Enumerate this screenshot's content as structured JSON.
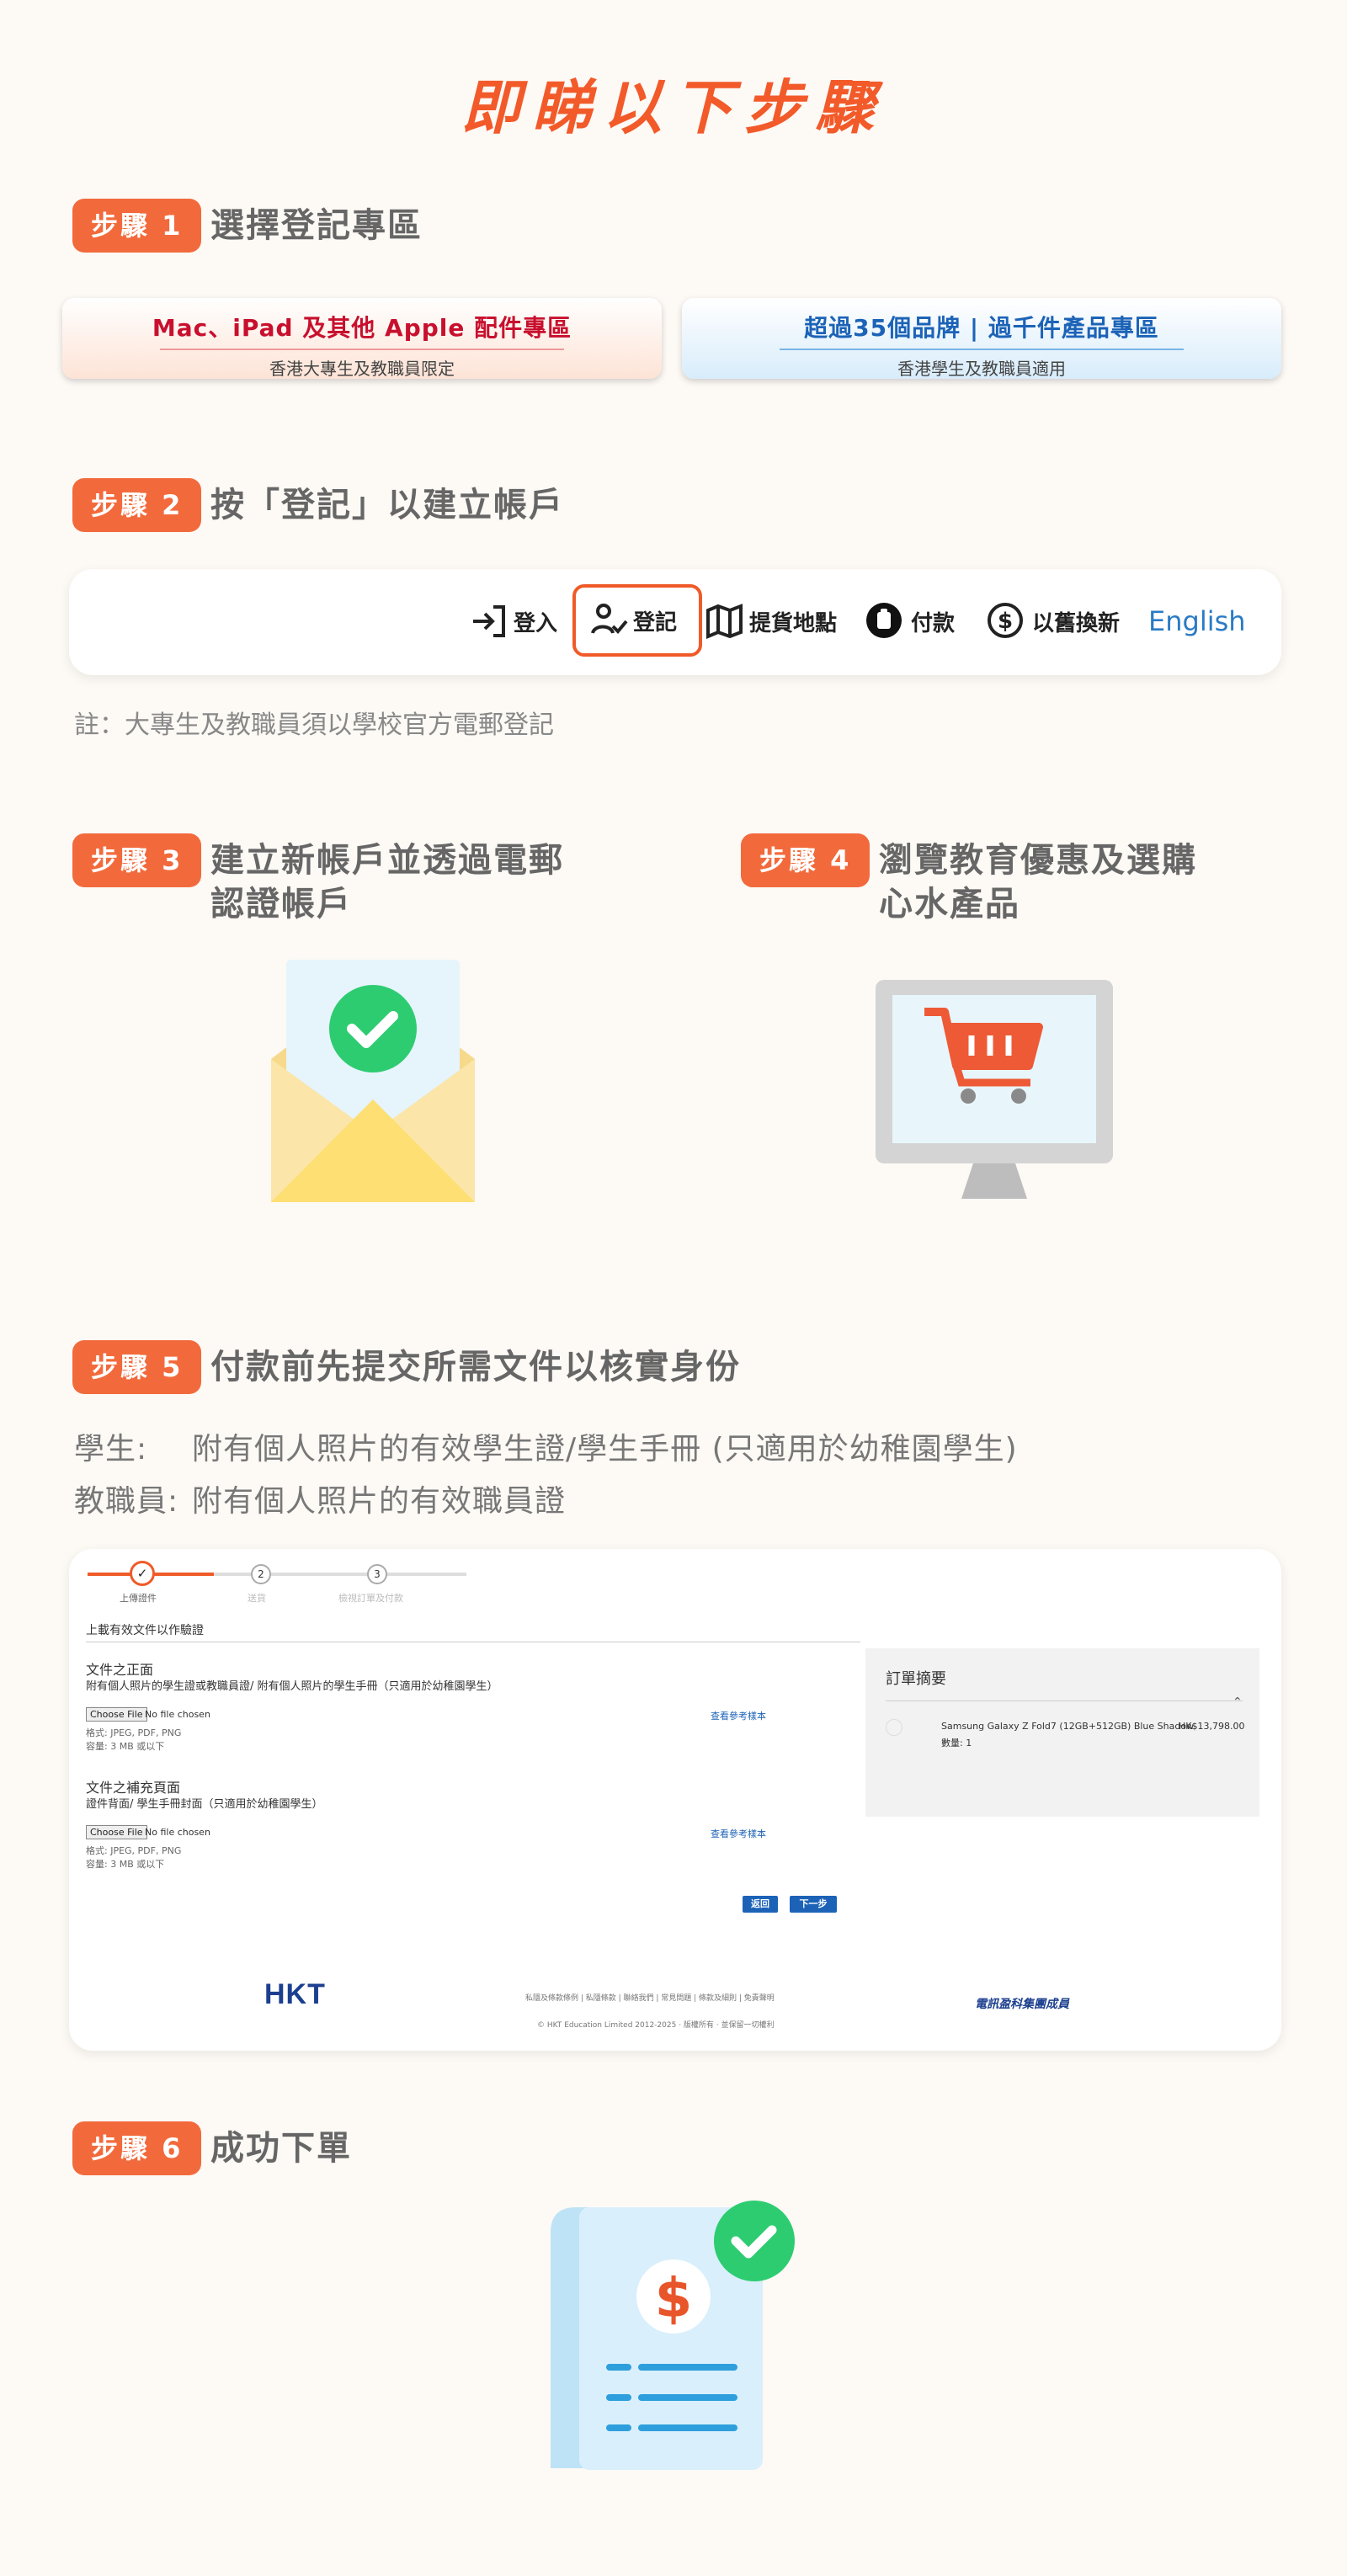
{
  "title": "即睇以下步驟",
  "steps": {
    "s1": {
      "badge": "步驟 1",
      "label": "選擇登記專區"
    },
    "s2": {
      "badge": "步驟 2",
      "label": "按「登記」以建立帳戶"
    },
    "s3": {
      "badge": "步驟 3",
      "label_line1": "建立新帳戶並透過電郵",
      "label_line2": "認證帳戶"
    },
    "s4": {
      "badge": "步驟 4",
      "label_line1": "瀏覽教育優惠及選購",
      "label_line2": "心水產品"
    },
    "s5": {
      "badge": "步驟 5",
      "label": "付款前先提交所需文件以核實身份"
    },
    "s6": {
      "badge": "步驟 6",
      "label": "成功下單"
    }
  },
  "zones": {
    "apple": {
      "title": "Mac、iPad 及其他 Apple 配件專區",
      "subtitle": "香港大專生及教職員限定"
    },
    "brands": {
      "title": "超過35個品牌 | 過千件產品專區",
      "subtitle": "香港學生及教職員適用"
    }
  },
  "nav": {
    "login": "登入",
    "register": "登記",
    "pickup": "提貨地點",
    "payment": "付款",
    "tradein": "以舊換新",
    "language": "English"
  },
  "note": "註：大專生及教職員須以學校官方電郵登記",
  "documents": {
    "student_label": "學生:",
    "student_text": "附有個人照片的有效學生證/學生手冊 (只適用於幼稚園學生)",
    "staff_label": "教職員:",
    "staff_text": "附有個人照片的有效職員證"
  },
  "form_screenshot": {
    "progress": [
      {
        "num": "✓",
        "label": "上傳證件"
      },
      {
        "num": "2",
        "label": "送貨"
      },
      {
        "num": "3",
        "label": "檢視訂單及付款"
      }
    ],
    "section_title": "上載有效文件以作驗證",
    "front_title": "文件之正面",
    "front_desc": "附有個人照片的學生證或教職員證/ 附有個人照片的學生手冊（只適用於幼稚園學生）",
    "choose_file": "Choose File",
    "no_file": "No file chosen",
    "format": "格式: JPEG, PDF, PNG",
    "size": "容量: 3 MB 或以下",
    "sample_link": "查看參考樣本",
    "back_title": "文件之補充頁面",
    "back_desc": "證件背面/ 學生手冊封面（只適用於幼稚園學生）",
    "back_button": "返回",
    "next_button": "下一步",
    "summary_title": "訂單摘要",
    "summary_item": "Samsung Galaxy Z Fold7 (12GB+512GB) Blue Shadow",
    "summary_price": "HK$13,798.00",
    "summary_qty": "數量: 1",
    "footer_logo": "HKT",
    "footer_links": "私隱及條款條例 | 私隱條款 | 聯絡我們 | 常見問題 | 條款及細則 | 免責聲明",
    "footer_copyright": "© HKT Education Limited 2012-2025 · 版權所有 · 並保留一切權利",
    "footer_partner": "電訊盈科集團成員"
  },
  "colors": {
    "accent": "#f25a2a",
    "badge": "#f26a3c",
    "green": "#2ecc71",
    "blue": "#1c63b7"
  }
}
